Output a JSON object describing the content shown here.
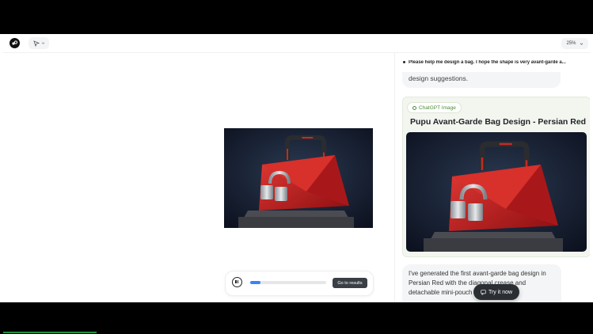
{
  "toolbar": {
    "zoom_label": "25%"
  },
  "icons": {
    "logo": "manus-logo-icon",
    "pointer": "cursor-arrow-icon",
    "chevron": "chevron-down-icon",
    "pause": "pause-icon",
    "try": "chat-bubble-icon",
    "gpt": "chatgpt-icon"
  },
  "player": {
    "progress": 0.14,
    "results_label": "Go to results"
  },
  "chat": {
    "task_title": "Please help me design a bag. I hope the shape is very avant-garde a...",
    "top_message": "design suggestions.",
    "card": {
      "chip_label": "ChatGPT Image",
      "title": "Pupu Avant-Garde Bag Design - Persian Red"
    },
    "bottom_message": "I've generated the first avant-garde bag design in Persian Red with the diagonal crease and detachable mini-pouch",
    "try_label": "Try it now"
  },
  "colors": {
    "accent_blue": "#3b82f6",
    "bag_red": "#c01a1a",
    "card_bg": "#f2f6ee",
    "chip_green": "#4c8c38"
  }
}
